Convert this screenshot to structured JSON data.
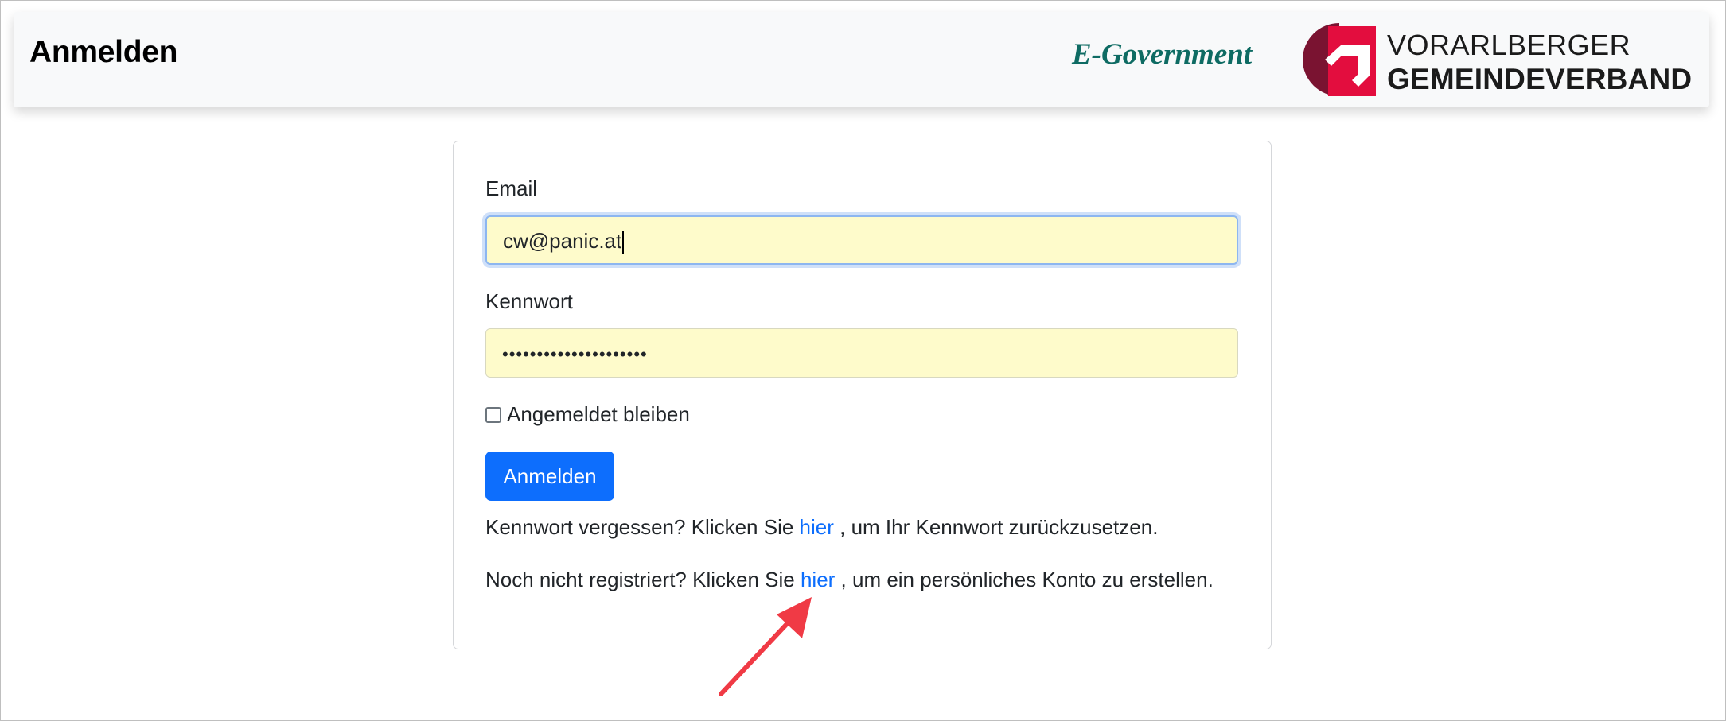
{
  "header": {
    "title": "Anmelden",
    "egov_text": "E-Government",
    "logo": {
      "line1": "VORARLBERGER",
      "line2": "GEMEINDEVERBAND"
    }
  },
  "form": {
    "email_label": "Email",
    "email_value": "cw@panic.at",
    "password_label": "Kennwort",
    "password_value": "•••••••••••••••••••••",
    "remember_label": "Angemeldet bleiben",
    "remember_checked": false,
    "submit_label": "Anmelden"
  },
  "forgot": {
    "prefix": "Kennwort vergessen? Klicken Sie ",
    "link": "hier",
    "suffix": " , um Ihr Kennwort zurückzusetzen."
  },
  "register": {
    "prefix": "Noch nicht registriert? Klicken Sie ",
    "link": "hier",
    "suffix": " , um ein persönliches Konto zu erstellen."
  },
  "colors": {
    "primary": "#0d6efd",
    "egov": "#0e6b63",
    "logo_red": "#e30d3e",
    "logo_dark": "#7a1331",
    "annotation_arrow": "#f03a45",
    "autofill_bg": "#fefbcb"
  }
}
